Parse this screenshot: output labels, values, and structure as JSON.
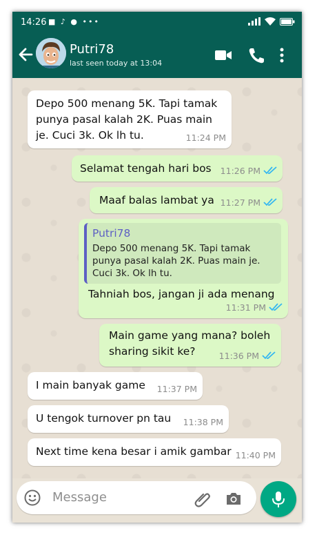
{
  "status_bar": {
    "time": "14:26",
    "notifications": "■ ♪ ● •••"
  },
  "header": {
    "contact_name": "Putri78",
    "contact_status": "last seen today at 13:04"
  },
  "messages": [
    {
      "direction": "in",
      "text": "Depo 500 menang 5K. Tapi tamak punya pasal kalah 2K. Puas main je. Cuci 3k. Ok lh tu.",
      "time": "11:24 PM"
    },
    {
      "direction": "out",
      "text": "Selamat tengah hari bos",
      "time": "11:26 PM",
      "read": true
    },
    {
      "direction": "out",
      "text": "Maaf balas lambat ya",
      "time": "11:27 PM",
      "read": true
    },
    {
      "direction": "out",
      "text": "Tahniah bos, jangan ji ada menang",
      "time": "11:31 PM",
      "read": true,
      "quote": {
        "author": "Putri78",
        "text": "Depo 500 menang 5K. Tapi tamak punya pasal kalah 2K. Puas main je. Cuci 3k. Ok lh tu."
      }
    },
    {
      "direction": "out",
      "text": "Main game yang mana? boleh sharing sikit ke?",
      "time": "11:36 PM",
      "read": true
    },
    {
      "direction": "in",
      "text": "I main banyak game",
      "time": "11:37 PM"
    },
    {
      "direction": "in",
      "text": "U tengok turnover pn tau",
      "time": "11:38 PM"
    },
    {
      "direction": "in",
      "text": "Next time kena besar i amik gambar",
      "time": "11:40 PM"
    }
  ],
  "input": {
    "placeholder": "Message"
  },
  "icons": {
    "back": "arrow-left-icon",
    "video": "video-call-icon",
    "call": "phone-icon",
    "menu": "more-vert-icon",
    "emoji": "emoji-icon",
    "attach": "paperclip-icon",
    "camera": "camera-icon",
    "mic": "mic-icon"
  },
  "colors": {
    "header": "#075e54",
    "outgoing": "#dcf8c6",
    "incoming": "#ffffff",
    "read_tick": "#34b7f1",
    "mic_button": "#00a884"
  }
}
